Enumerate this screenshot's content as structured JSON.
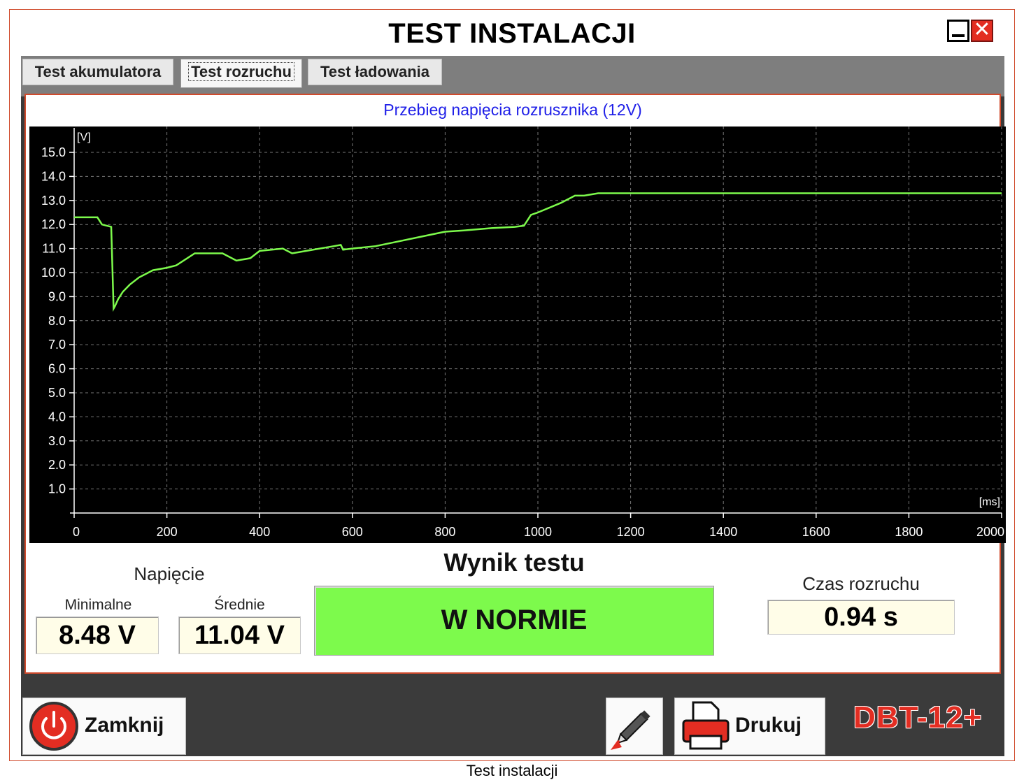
{
  "window": {
    "title": "TEST INSTALACJI",
    "close_glyph": "✕"
  },
  "tabs": [
    {
      "label": "Test akumulatora",
      "active": false
    },
    {
      "label": "Test rozruchu",
      "active": true
    },
    {
      "label": "Test ładowania",
      "active": false
    }
  ],
  "chart_data": {
    "type": "line",
    "title": "Przebieg napięcia rozrusznika (12V)",
    "ylabel": "[V]",
    "xlabel": "[ms]",
    "ylim": [
      0,
      15.5
    ],
    "xlim": [
      0,
      2000
    ],
    "yticks": [
      "15.0",
      "14.0",
      "13.0",
      "12.0",
      "11.0",
      "10.0",
      "9.0",
      "8.0",
      "7.0",
      "6.0",
      "5.0",
      "4.0",
      "3.0",
      "2.0",
      "1.0"
    ],
    "xticks": [
      "0",
      "200",
      "400",
      "600",
      "800",
      "1000",
      "1200",
      "1400",
      "1600",
      "1800",
      "2000"
    ],
    "grid": true,
    "background": "#000000",
    "line_color": "#7dfa4c",
    "series": [
      {
        "x": [
          0,
          50,
          60,
          80,
          85,
          88,
          95,
          105,
          120,
          140,
          170,
          200,
          220,
          260,
          320,
          350,
          380,
          400,
          450,
          470,
          500,
          560,
          575,
          580,
          600,
          650,
          700,
          750,
          800,
          840,
          900,
          950,
          970,
          985,
          1000,
          1050,
          1080,
          1100,
          1130,
          1200,
          2000
        ],
        "y": [
          12.3,
          12.3,
          12.0,
          11.9,
          8.5,
          8.6,
          8.9,
          9.2,
          9.5,
          9.8,
          10.1,
          10.2,
          10.3,
          10.8,
          10.8,
          10.5,
          10.6,
          10.9,
          11.0,
          10.8,
          10.9,
          11.1,
          11.15,
          10.95,
          11.0,
          11.1,
          11.3,
          11.5,
          11.7,
          11.75,
          11.85,
          11.9,
          11.95,
          12.4,
          12.5,
          12.9,
          13.2,
          13.2,
          13.3,
          13.3,
          13.3
        ]
      }
    ]
  },
  "results": {
    "voltage_label": "Napięcie",
    "min_label": "Minimalne",
    "min_value": "8.48 V",
    "avg_label": "Średnie",
    "avg_value": "11.04 V",
    "result_label": "Wynik testu",
    "result_value": "W NORMIE",
    "result_color": "#7dfa4c",
    "crank_label": "Czas rozruchu",
    "crank_value": "0.94 s"
  },
  "footer": {
    "close_label": "Zamknij",
    "edit_icon": "pencil-icon",
    "print_label": "Drukuj",
    "brand": "DBT-12+"
  },
  "caption": "Test instalacji"
}
